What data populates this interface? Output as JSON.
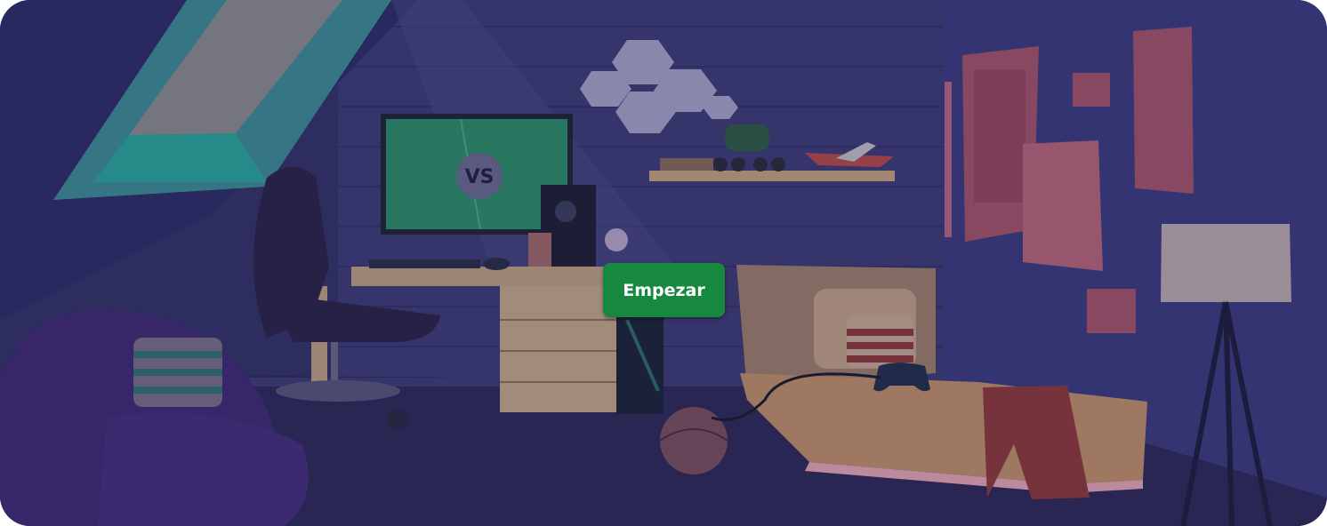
{
  "scene": {
    "monitor_label": "VS",
    "colors": {
      "wall": "#3b3a73",
      "floor": "#2f2a5a",
      "screen": "#2f8f6a",
      "button": "#17893e",
      "button_text": "#ffffff",
      "poster": "#a4546a",
      "bed": "#c09068"
    }
  },
  "start_button": {
    "label": "Empezar"
  }
}
